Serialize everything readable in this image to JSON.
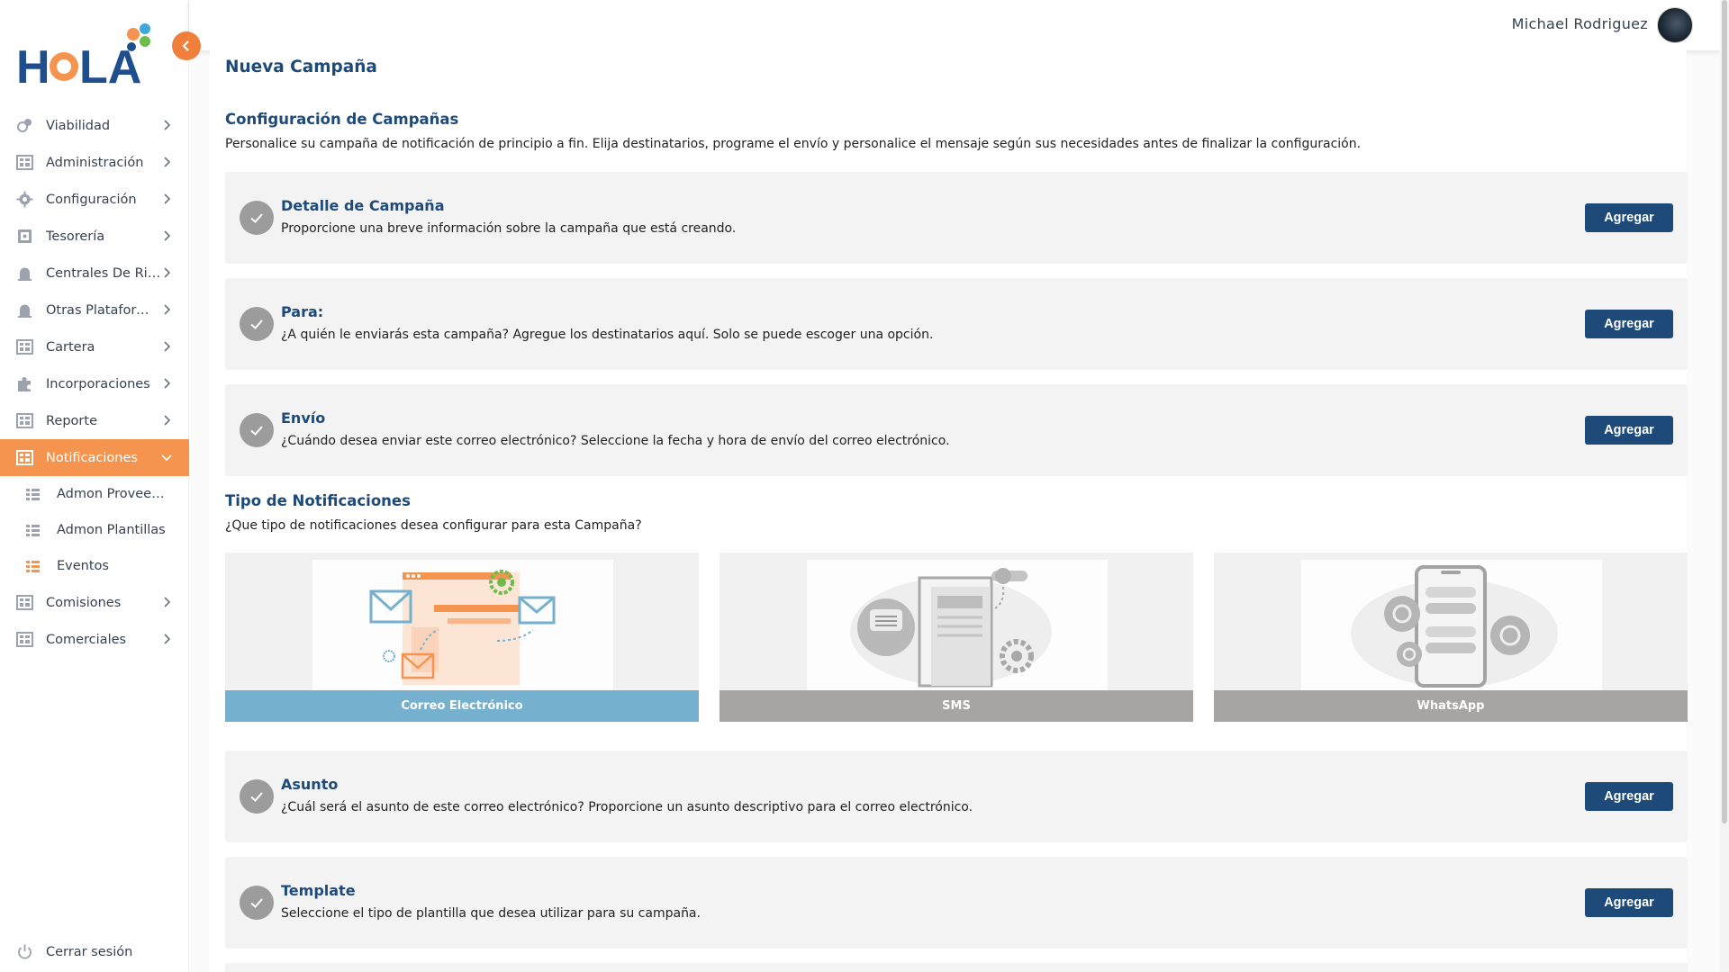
{
  "app": {
    "logo_text": "HOLA"
  },
  "header": {
    "user_name": "Michael Rodriguez"
  },
  "sidebar": {
    "items": [
      {
        "label": "Viabilidad"
      },
      {
        "label": "Administración"
      },
      {
        "label": "Configuración"
      },
      {
        "label": "Tesorería"
      },
      {
        "label": "Centrales De Riesgo"
      },
      {
        "label": "Otras Plataformas"
      },
      {
        "label": "Cartera"
      },
      {
        "label": "Incorporaciones"
      },
      {
        "label": "Reporte"
      },
      {
        "label": "Notificaciones"
      },
      {
        "label": "Comisiones"
      },
      {
        "label": "Comerciales"
      }
    ],
    "subitems": [
      {
        "label": "Admon Proveedores"
      },
      {
        "label": "Admon Plantillas"
      },
      {
        "label": "Eventos"
      }
    ],
    "logout_label": "Cerrar sesión",
    "active_color": "#f5944f"
  },
  "main": {
    "page_title": "Nueva Campaña",
    "config": {
      "title": "Configuración de Campañas",
      "description": "Personalice su campaña de notificación de principio a fin. Elija destinatarios, programe el envío y personalice el mensaje según sus necesidades antes de finalizar la configuración."
    },
    "cards_top": [
      {
        "title": "Detalle de Campaña",
        "description": "Proporcione una breve información sobre la campaña que está creando.",
        "button": "Agregar"
      },
      {
        "title": "Para:",
        "description": "¿A quién le enviarás esta campaña? Agregue los destinatarios aquí. Solo se puede escoger una opción.",
        "button": "Agregar"
      },
      {
        "title": "Envío",
        "description": "¿Cuándo desea enviar este correo electrónico? Seleccione la fecha y hora de envío del correo electrónico.",
        "button": "Agregar"
      }
    ],
    "notification_types": {
      "title": "Tipo de Notificaciones",
      "description": "¿Que tipo de notificaciones desea configurar para esta Campaña?",
      "options": [
        {
          "label": "Correo Electrónico",
          "selected": true
        },
        {
          "label": "SMS",
          "selected": false
        },
        {
          "label": "WhatsApp",
          "selected": false
        }
      ]
    },
    "cards_bottom": [
      {
        "title": "Asunto",
        "description": "¿Cuál será el asunto de este correo electrónico? Proporcione un asunto descriptivo para el correo electrónico.",
        "button": "Agregar"
      },
      {
        "title": "Template",
        "description": "Seleccione el tipo de plantilla que desea utilizar para su campaña.",
        "button": "Agregar"
      }
    ]
  },
  "colors": {
    "primary": "#1e4a7a",
    "accent": "#f07f3c",
    "selected_tile": "#76b0cf",
    "unselected_tile": "#a7a4a4"
  }
}
